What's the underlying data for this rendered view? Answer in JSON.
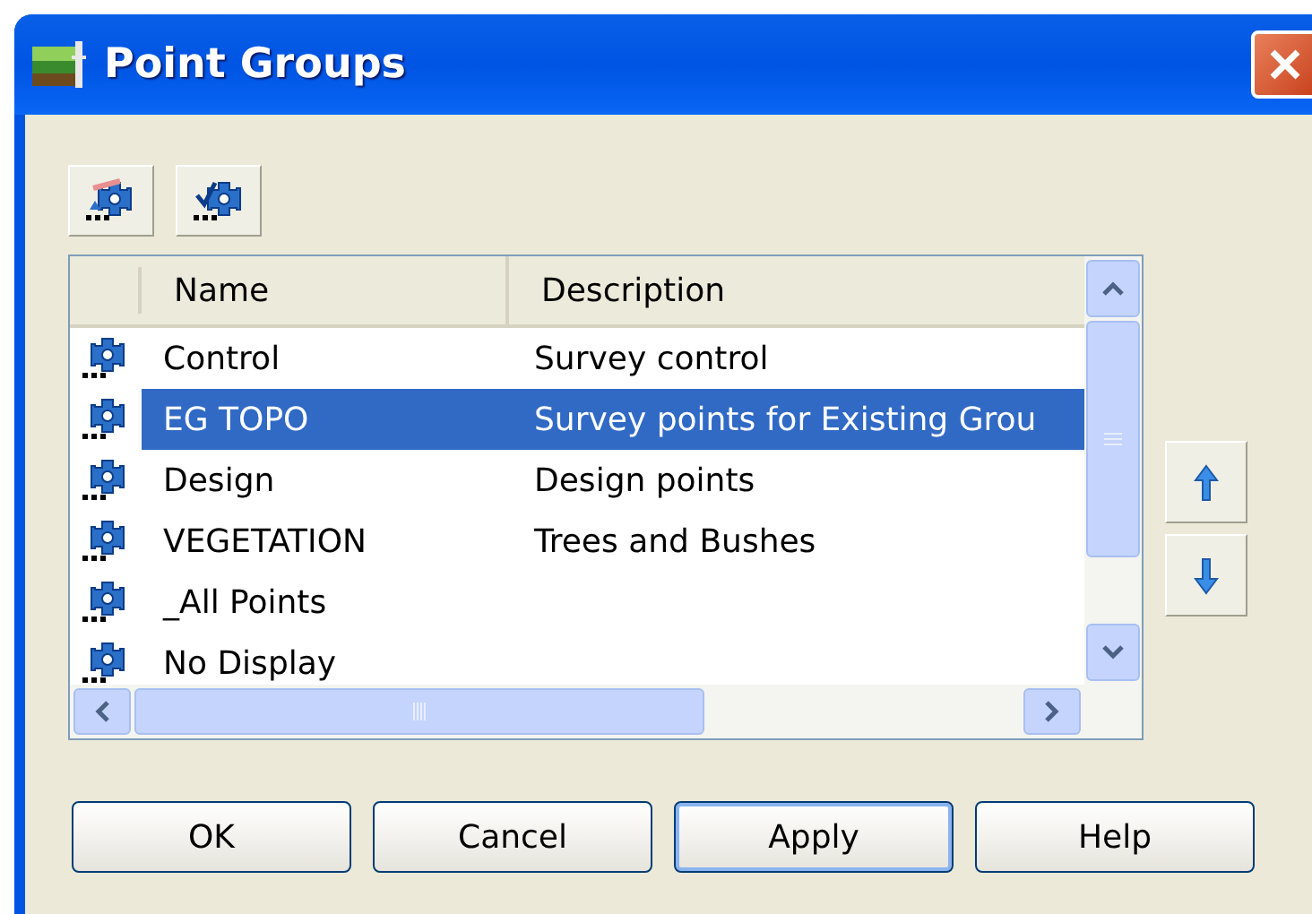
{
  "window": {
    "title": "Point Groups"
  },
  "toolbar": [
    {
      "kind": "properties"
    },
    {
      "kind": "check"
    }
  ],
  "table": {
    "columns": [
      "Name",
      "Description"
    ],
    "rows": [
      {
        "name": "Control",
        "description": "Survey control",
        "selected": false
      },
      {
        "name": "EG TOPO",
        "description": "Survey points for Existing Grou",
        "selected": true
      },
      {
        "name": "Design",
        "description": "Design points",
        "selected": false
      },
      {
        "name": "VEGETATION",
        "description": "Trees and Bushes",
        "selected": false
      },
      {
        "name": "_All Points",
        "description": "",
        "selected": false
      },
      {
        "name": "No Display",
        "description": "",
        "selected": false
      }
    ]
  },
  "order_buttons": [
    {
      "kind": "up"
    },
    {
      "kind": "down"
    }
  ],
  "buttons": [
    {
      "label": "OK",
      "focused": false
    },
    {
      "label": "Cancel",
      "focused": false
    },
    {
      "label": "Apply",
      "focused": true
    },
    {
      "label": "Help",
      "focused": false
    }
  ]
}
